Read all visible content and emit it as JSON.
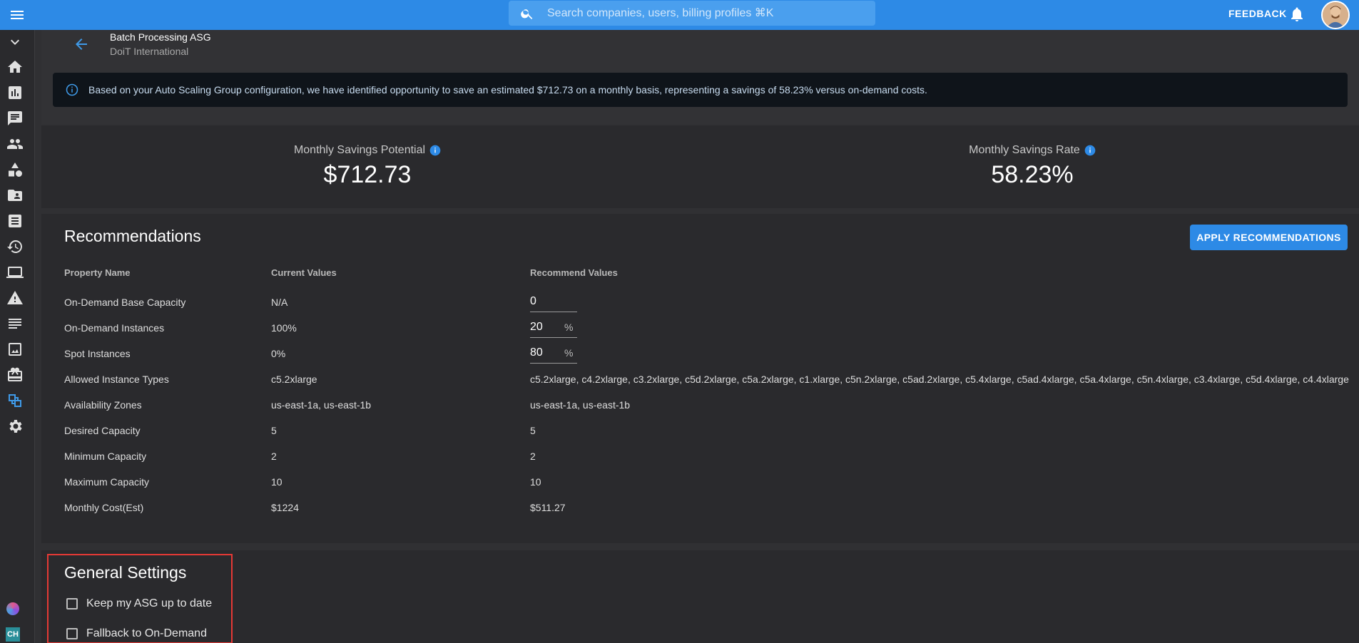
{
  "colors": {
    "topbar": "#2d8ae6",
    "background": "#303033",
    "card": "#2a2a2d",
    "info_bar": "#0f141a",
    "highlight": "#e53935"
  },
  "header": {
    "search_placeholder": "Search companies, users, billing profiles ⌘K",
    "feedback_label": "FEEDBACK"
  },
  "sidebar": {
    "items": [
      "chevron-down-icon",
      "home-icon",
      "chart-icon",
      "chat-icon",
      "people-icon",
      "shapes-icon",
      "folder-icon",
      "receipt-icon",
      "history-icon",
      "laptop-icon",
      "warning-icon",
      "list-icon",
      "image-icon",
      "gift-icon",
      "spot-icon",
      "gear-icon"
    ],
    "bottom_badge": "CH"
  },
  "asg": {
    "title": "Batch Processing ASG",
    "subtitle": "DoiT International"
  },
  "info_message": "Based on your Auto Scaling Group configuration, we have identified opportunity to save an estimated $712.73 on a monthly basis, representing a savings of 58.23% versus on-demand costs.",
  "stats": {
    "savings_potential": {
      "label": "Monthly Savings Potential",
      "value": "$712.73"
    },
    "savings_rate": {
      "label": "Monthly Savings Rate",
      "value": "58.23%"
    }
  },
  "recommendations": {
    "title": "Recommendations",
    "apply_label": "APPLY RECOMMENDATIONS",
    "columns": [
      "Property Name",
      "Current Values",
      "Recommend Values"
    ],
    "rows": [
      {
        "name": "On-Demand Base Capacity",
        "current": "N/A",
        "recommended": "0",
        "input": true,
        "suffix": ""
      },
      {
        "name": "On-Demand Instances",
        "current": "100%",
        "recommended": "20",
        "input": true,
        "suffix": "%"
      },
      {
        "name": "Spot Instances",
        "current": "0%",
        "recommended": "80",
        "input": true,
        "suffix": "%"
      },
      {
        "name": "Allowed Instance Types",
        "current": "c5.2xlarge",
        "recommended": "c5.2xlarge, c4.2xlarge, c3.2xlarge, c5d.2xlarge, c5a.2xlarge, c1.xlarge, c5n.2xlarge, c5ad.2xlarge, c5.4xlarge, c5ad.4xlarge, c5a.4xlarge, c5n.4xlarge, c3.4xlarge, c5d.4xlarge, c4.4xlarge"
      },
      {
        "name": "Availability Zones",
        "current": "us-east-1a, us-east-1b",
        "recommended": "us-east-1a, us-east-1b"
      },
      {
        "name": "Desired Capacity",
        "current": "5",
        "recommended": "5"
      },
      {
        "name": "Minimum Capacity",
        "current": "2",
        "recommended": "2"
      },
      {
        "name": "Maximum Capacity",
        "current": "10",
        "recommended": "10"
      },
      {
        "name": "Monthly Cost(Est)",
        "current": "$1224",
        "recommended": "$511.27"
      }
    ]
  },
  "general_settings": {
    "title": "General Settings",
    "options": [
      {
        "label": "Keep my ASG up to date",
        "checked": false
      },
      {
        "label": "Fallback to On-Demand",
        "checked": false
      }
    ]
  }
}
